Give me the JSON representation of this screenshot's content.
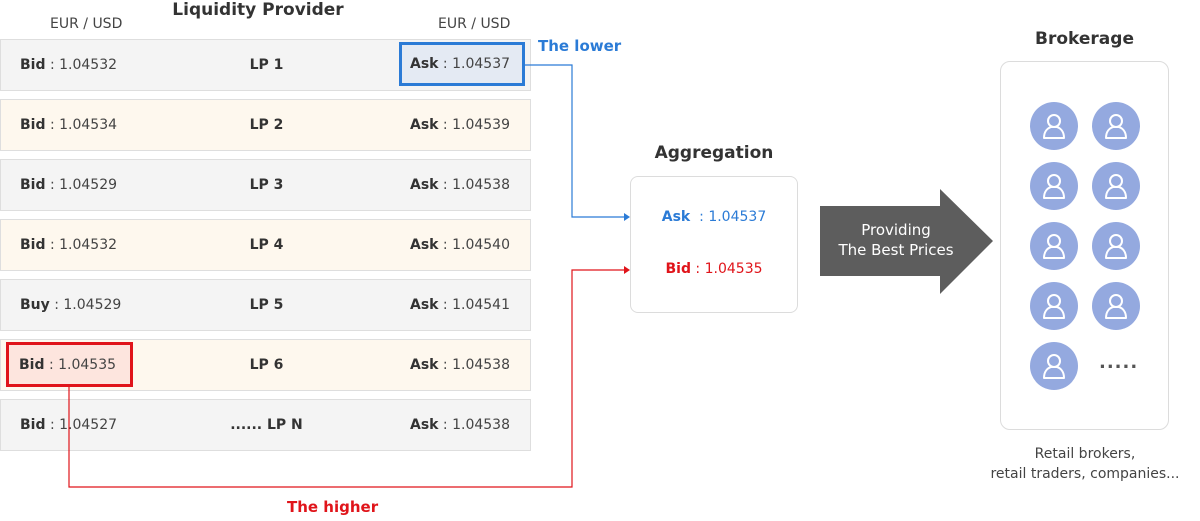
{
  "liquidity_provider": {
    "title": "Liquidity Provider",
    "left_pair": "EUR / USD",
    "right_pair": "EUR / USD",
    "rows": [
      {
        "bid_label": "Bid",
        "bid_value": "1.04532",
        "lp": "LP 1",
        "ask_label": "Ask",
        "ask_value": "1.04537",
        "style": "gray"
      },
      {
        "bid_label": "Bid",
        "bid_value": "1.04534",
        "lp": "LP 2",
        "ask_label": "Ask",
        "ask_value": "1.04539",
        "style": "cream"
      },
      {
        "bid_label": "Bid",
        "bid_value": "1.04529",
        "lp": "LP 3",
        "ask_label": "Ask",
        "ask_value": "1.04538",
        "style": "gray"
      },
      {
        "bid_label": "Bid",
        "bid_value": "1.04532",
        "lp": "LP 4",
        "ask_label": "Ask",
        "ask_value": "1.04540",
        "style": "cream"
      },
      {
        "bid_label": "Buy",
        "bid_value": "1.04529",
        "lp": "LP 5",
        "ask_label": "Ask",
        "ask_value": "1.04541",
        "style": "gray"
      },
      {
        "bid_label": "Bid",
        "bid_value": "1.04535",
        "lp": "LP 6",
        "ask_label": "Ask",
        "ask_value": "1.04538",
        "style": "cream"
      },
      {
        "bid_label": "Bid",
        "bid_value": "1.04527",
        "lp": "...... LP N",
        "ask_label": "Ask",
        "ask_value": "1.04538",
        "style": "gray"
      }
    ]
  },
  "annotations": {
    "lower": "The lower",
    "higher": "The higher",
    "lower_color": "#2b7bd6",
    "higher_color": "#e0141a"
  },
  "aggregation": {
    "title": "Aggregation",
    "ask_label": "Ask",
    "ask_value": "1.04537",
    "bid_label": "Bid",
    "bid_value": "1.04535"
  },
  "arrow": {
    "line1": "Providing",
    "line2": "The Best Prices"
  },
  "brokerage": {
    "title": "Brokerage",
    "more": ".....",
    "caption_line1": "Retail brokers,",
    "caption_line2": "retail traders, companies..."
  }
}
